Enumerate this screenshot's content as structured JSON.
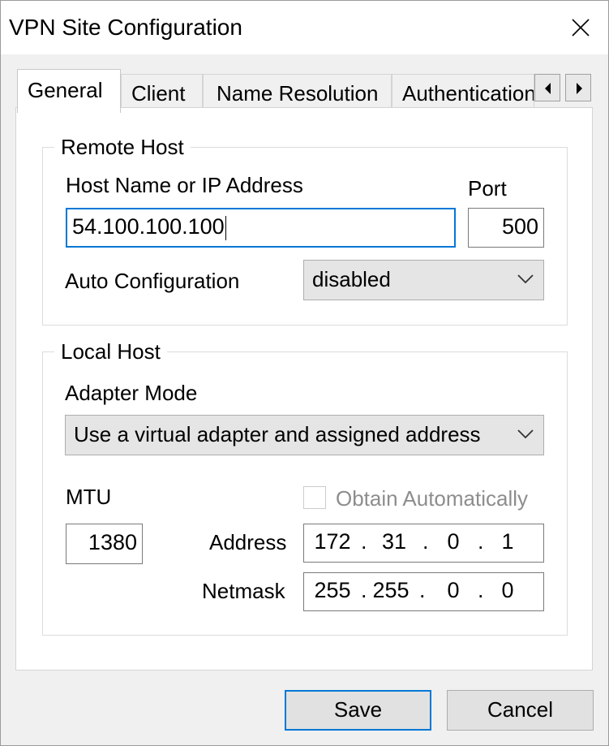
{
  "window": {
    "title": "VPN Site Configuration"
  },
  "tabs": [
    {
      "label": "General",
      "active": true
    },
    {
      "label": "Client",
      "active": false
    },
    {
      "label": "Name Resolution",
      "active": false
    },
    {
      "label": "Authentication",
      "active": false
    }
  ],
  "remote_host": {
    "group_label": "Remote Host",
    "host_label": "Host Name or IP Address",
    "host_value": "54.100.100.100",
    "port_label": "Port",
    "port_value": "500",
    "auto_config_label": "Auto Configuration",
    "auto_config_value": "disabled"
  },
  "local_host": {
    "group_label": "Local Host",
    "adapter_mode_label": "Adapter Mode",
    "adapter_mode_value": "Use a virtual adapter and assigned address",
    "mtu_label": "MTU",
    "mtu_value": "1380",
    "obtain_auto_label": "Obtain Automatically",
    "obtain_auto_checked": false,
    "address_label": "Address",
    "address": [
      "172",
      "31",
      "0",
      "1"
    ],
    "netmask_label": "Netmask",
    "netmask": [
      "255",
      "255",
      "0",
      "0"
    ]
  },
  "buttons": {
    "save": "Save",
    "cancel": "Cancel"
  },
  "colors": {
    "focus_accent": "#0078d7",
    "disabled_text": "#8d8d8d"
  }
}
